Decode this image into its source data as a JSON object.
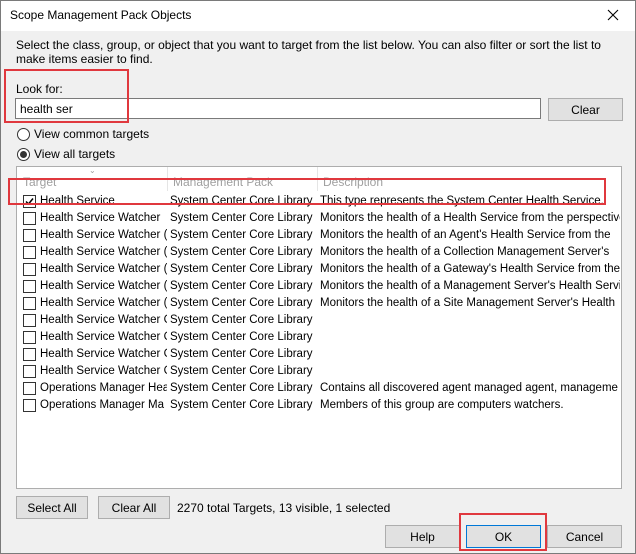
{
  "dialog": {
    "title": "Scope Management Pack Objects",
    "close_glyph": "✕",
    "instructions": "Select the class, group, or object that you want to target from the list below. You can also filter or sort the list to make items easier to find."
  },
  "filter": {
    "look_for_label": "Look for:",
    "search_value": "health ser",
    "clear_label": "Clear"
  },
  "view_options": [
    {
      "label": "View common targets",
      "selected": false
    },
    {
      "label": "View all targets",
      "selected": true
    }
  ],
  "list": {
    "columns": [
      "Target",
      "Management Pack",
      "Description"
    ],
    "sorted_column": "Target",
    "rows": [
      {
        "target": "Health Service",
        "pack": "System Center Core Library",
        "description": "This type represents the System Center Health Service.",
        "checked": true
      },
      {
        "target": "Health Service Watcher",
        "pack": "System Center Core Library",
        "description": "Monitors the health of a Health Service from the perspective",
        "checked": false
      },
      {
        "target": "Health Service Watcher (",
        "pack": "System Center Core Library",
        "description": "Monitors the health of an Agent's Health Service from the",
        "checked": false
      },
      {
        "target": "Health Service Watcher (",
        "pack": "System Center Core Library",
        "description": "Monitors the health of a Collection Management Server's",
        "checked": false
      },
      {
        "target": "Health Service Watcher (",
        "pack": "System Center Core Library",
        "description": "Monitors the health of a Gateway's Health Service from the",
        "checked": false
      },
      {
        "target": "Health Service Watcher (",
        "pack": "System Center Core Library",
        "description": "Monitors the health of a Management Server's Health Servi",
        "checked": false
      },
      {
        "target": "Health Service Watcher (",
        "pack": "System Center Core Library",
        "description": "Monitors the health of a Site Management Server's Health",
        "checked": false
      },
      {
        "target": "Health Service Watcher G",
        "pack": "System Center Core Library",
        "description": "",
        "checked": false
      },
      {
        "target": "Health Service Watcher G",
        "pack": "System Center Core Library",
        "description": "",
        "checked": false
      },
      {
        "target": "Health Service Watcher G",
        "pack": "System Center Core Library",
        "description": "",
        "checked": false
      },
      {
        "target": "Health Service Watcher G",
        "pack": "System Center Core Library",
        "description": "",
        "checked": false
      },
      {
        "target": "Operations Manager Hea",
        "pack": "System Center Core Library",
        "description": "Contains all discovered agent managed agent, manageme",
        "checked": false
      },
      {
        "target": "Operations Manager Ma",
        "pack": "System Center Core Library",
        "description": "Members of this group are computers watchers.",
        "checked": false
      }
    ]
  },
  "footer": {
    "select_all_label": "Select All",
    "clear_all_label": "Clear All",
    "status_text": "2270 total Targets, 13 visible, 1 selected",
    "help_label": "Help",
    "ok_label": "OK",
    "cancel_label": "Cancel"
  },
  "highlight_color": "#e0383e"
}
